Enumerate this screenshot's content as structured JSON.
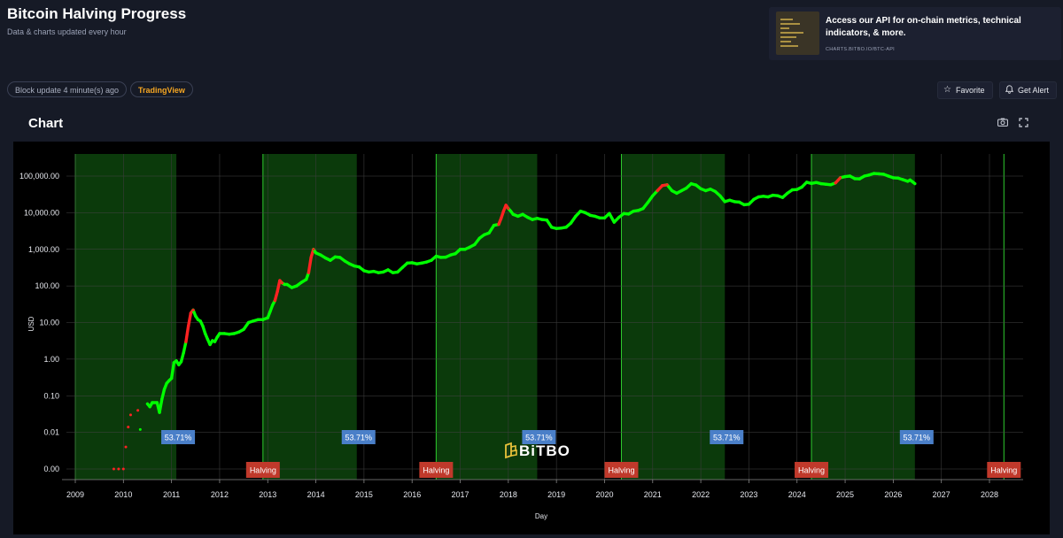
{
  "header": {
    "title": "Bitcoin Halving Progress",
    "subtitle": "Data & charts updated every hour"
  },
  "promo": {
    "text": "Access our API for on-chain metrics, technical indicators, & more.",
    "link": "CHARTS.BITBO.IO/BTC-API"
  },
  "toolbar": {
    "block_update": "Block update 4 minute(s) ago",
    "tradingview": "TradingView",
    "favorite": "Favorite",
    "get_alert": "Get Alert"
  },
  "chart_section": {
    "title": "Chart",
    "watermark": "BiTBO"
  },
  "colors": {
    "page_bg": "#161a26",
    "plot_bg": "#000000",
    "band": "#0b3a0b",
    "band_edge": "#2ecc2e",
    "price": "#00ff00",
    "price_hot": "#ff2222",
    "halving_label": "#c0392b",
    "pct_label": "#4a7fc8"
  },
  "icons": {
    "favorite": "star-icon",
    "alert": "bell-icon",
    "snapshot": "camera-icon",
    "fullscreen": "fullscreen-icon"
  },
  "chart_data": {
    "type": "scatter",
    "xlabel": "Day",
    "ylabel": "USD",
    "xlim": [
      2009,
      2028.4
    ],
    "ylim": [
      0.001,
      300000
    ],
    "y_scale": "log",
    "x_ticks": [
      "2009",
      "2010",
      "2011",
      "2012",
      "2013",
      "2014",
      "2015",
      "2016",
      "2017",
      "2018",
      "2019",
      "2020",
      "2021",
      "2022",
      "2023",
      "2024",
      "2025",
      "2026",
      "2027",
      "2028"
    ],
    "y_ticks": [
      {
        "value": 100000,
        "label": "100,000.00"
      },
      {
        "value": 10000,
        "label": "10,000.00"
      },
      {
        "value": 1000,
        "label": "1,000.00"
      },
      {
        "value": 100,
        "label": "100.00"
      },
      {
        "value": 10,
        "label": "10.00"
      },
      {
        "value": 1,
        "label": "1.00"
      },
      {
        "value": 0.1,
        "label": "0.10"
      },
      {
        "value": 0.01,
        "label": "0.01"
      },
      {
        "value": 0.001,
        "label": "0.00"
      }
    ],
    "grid": true,
    "bands": [
      {
        "start": 2009.0,
        "end": 2011.1
      },
      {
        "start": 2012.9,
        "end": 2014.85
      },
      {
        "start": 2016.5,
        "end": 2018.6
      },
      {
        "start": 2020.35,
        "end": 2022.5
      },
      {
        "start": 2024.3,
        "end": 2026.45
      },
      {
        "start": 2028.3,
        "end": 2028.3
      }
    ],
    "band_labels": [
      {
        "x": 2011.1,
        "label": "53.71%"
      },
      {
        "x": 2014.85,
        "label": "53.71%"
      },
      {
        "x": 2018.6,
        "label": "53.71%"
      },
      {
        "x": 2022.5,
        "label": "53.71%"
      },
      {
        "x": 2026.45,
        "label": "53.71%"
      }
    ],
    "halvings": [
      {
        "x": 2012.9,
        "label": "Halving"
      },
      {
        "x": 2016.5,
        "label": "Halving"
      },
      {
        "x": 2020.35,
        "label": "Halving"
      },
      {
        "x": 2024.3,
        "label": "Halving"
      },
      {
        "x": 2028.3,
        "label": "Halving"
      }
    ],
    "series": [
      {
        "points": [
          [
            2009.8,
            0.001
          ],
          [
            2009.9,
            0.001
          ],
          [
            2010.0,
            0.001
          ],
          [
            2010.05,
            0.004
          ],
          [
            2010.1,
            0.014
          ],
          [
            2010.15,
            0.03
          ],
          [
            2010.3,
            0.04
          ],
          [
            2010.35,
            0.012
          ],
          [
            2010.5,
            0.06
          ],
          [
            2010.55,
            0.05
          ],
          [
            2010.6,
            0.065
          ],
          [
            2010.7,
            0.065
          ],
          [
            2010.75,
            0.035
          ],
          [
            2010.8,
            0.08
          ],
          [
            2010.85,
            0.15
          ],
          [
            2010.9,
            0.22
          ],
          [
            2010.95,
            0.26
          ],
          [
            2011.0,
            0.3
          ],
          [
            2011.05,
            0.8
          ],
          [
            2011.1,
            0.9
          ],
          [
            2011.15,
            0.7
          ],
          [
            2011.2,
            0.85
          ],
          [
            2011.25,
            1.5
          ],
          [
            2011.3,
            3
          ],
          [
            2011.35,
            8
          ],
          [
            2011.4,
            18
          ],
          [
            2011.45,
            22
          ],
          [
            2011.5,
            15
          ],
          [
            2011.55,
            12
          ],
          [
            2011.6,
            11
          ],
          [
            2011.65,
            8
          ],
          [
            2011.7,
            5
          ],
          [
            2011.75,
            3.5
          ],
          [
            2011.8,
            2.5
          ],
          [
            2011.85,
            3.2
          ],
          [
            2011.9,
            3
          ],
          [
            2011.95,
            4
          ],
          [
            2012.0,
            5
          ],
          [
            2012.1,
            5
          ],
          [
            2012.2,
            4.8
          ],
          [
            2012.3,
            5
          ],
          [
            2012.4,
            5.5
          ],
          [
            2012.5,
            6.5
          ],
          [
            2012.6,
            10
          ],
          [
            2012.7,
            11
          ],
          [
            2012.8,
            12
          ],
          [
            2012.9,
            12
          ],
          [
            2013.0,
            13.5
          ],
          [
            2013.05,
            20
          ],
          [
            2013.1,
            30
          ],
          [
            2013.15,
            40
          ],
          [
            2013.2,
            70
          ],
          [
            2013.25,
            140
          ],
          [
            2013.3,
            120
          ],
          [
            2013.35,
            110
          ],
          [
            2013.4,
            110
          ],
          [
            2013.5,
            90
          ],
          [
            2013.6,
            100
          ],
          [
            2013.7,
            125
          ],
          [
            2013.8,
            150
          ],
          [
            2013.85,
            230
          ],
          [
            2013.9,
            600
          ],
          [
            2013.95,
            1000
          ],
          [
            2014.0,
            800
          ],
          [
            2014.1,
            700
          ],
          [
            2014.2,
            580
          ],
          [
            2014.3,
            500
          ],
          [
            2014.4,
            620
          ],
          [
            2014.5,
            600
          ],
          [
            2014.6,
            480
          ],
          [
            2014.7,
            400
          ],
          [
            2014.8,
            350
          ],
          [
            2014.9,
            330
          ],
          [
            2015.0,
            260
          ],
          [
            2015.1,
            240
          ],
          [
            2015.2,
            250
          ],
          [
            2015.3,
            230
          ],
          [
            2015.4,
            240
          ],
          [
            2015.5,
            275
          ],
          [
            2015.6,
            230
          ],
          [
            2015.7,
            240
          ],
          [
            2015.8,
            320
          ],
          [
            2015.9,
            420
          ],
          [
            2016.0,
            430
          ],
          [
            2016.1,
            400
          ],
          [
            2016.2,
            420
          ],
          [
            2016.3,
            450
          ],
          [
            2016.4,
            500
          ],
          [
            2016.5,
            650
          ],
          [
            2016.6,
            600
          ],
          [
            2016.7,
            610
          ],
          [
            2016.8,
            700
          ],
          [
            2016.9,
            760
          ],
          [
            2017.0,
            1000
          ],
          [
            2017.1,
            1000
          ],
          [
            2017.2,
            1150
          ],
          [
            2017.3,
            1350
          ],
          [
            2017.4,
            2000
          ],
          [
            2017.5,
            2500
          ],
          [
            2017.6,
            2800
          ],
          [
            2017.7,
            4500
          ],
          [
            2017.8,
            4800
          ],
          [
            2017.85,
            7000
          ],
          [
            2017.9,
            11000
          ],
          [
            2017.95,
            16000
          ],
          [
            2018.0,
            13000
          ],
          [
            2018.05,
            11000
          ],
          [
            2018.1,
            9000
          ],
          [
            2018.2,
            8000
          ],
          [
            2018.3,
            9000
          ],
          [
            2018.4,
            7500
          ],
          [
            2018.5,
            6500
          ],
          [
            2018.6,
            7000
          ],
          [
            2018.7,
            6500
          ],
          [
            2018.8,
            6300
          ],
          [
            2018.9,
            4000
          ],
          [
            2019.0,
            3700
          ],
          [
            2019.1,
            3800
          ],
          [
            2019.2,
            4000
          ],
          [
            2019.3,
            5200
          ],
          [
            2019.4,
            8000
          ],
          [
            2019.5,
            11000
          ],
          [
            2019.6,
            10000
          ],
          [
            2019.7,
            8500
          ],
          [
            2019.8,
            8000
          ],
          [
            2019.9,
            7200
          ],
          [
            2020.0,
            7200
          ],
          [
            2020.1,
            9500
          ],
          [
            2020.2,
            5500
          ],
          [
            2020.3,
            7500
          ],
          [
            2020.4,
            9500
          ],
          [
            2020.5,
            9200
          ],
          [
            2020.6,
            11000
          ],
          [
            2020.7,
            11500
          ],
          [
            2020.8,
            13000
          ],
          [
            2020.9,
            19000
          ],
          [
            2021.0,
            29000
          ],
          [
            2021.1,
            40000
          ],
          [
            2021.2,
            55000
          ],
          [
            2021.3,
            58000
          ],
          [
            2021.4,
            40000
          ],
          [
            2021.5,
            34000
          ],
          [
            2021.6,
            40000
          ],
          [
            2021.7,
            47000
          ],
          [
            2021.8,
            62000
          ],
          [
            2021.9,
            57000
          ],
          [
            2022.0,
            45000
          ],
          [
            2022.1,
            40000
          ],
          [
            2022.2,
            44000
          ],
          [
            2022.3,
            38000
          ],
          [
            2022.4,
            29000
          ],
          [
            2022.5,
            20000
          ],
          [
            2022.6,
            22000
          ],
          [
            2022.7,
            20000
          ],
          [
            2022.8,
            19500
          ],
          [
            2022.9,
            16500
          ],
          [
            2023.0,
            17000
          ],
          [
            2023.1,
            23000
          ],
          [
            2023.2,
            27000
          ],
          [
            2023.3,
            28000
          ],
          [
            2023.4,
            27000
          ],
          [
            2023.5,
            30000
          ],
          [
            2023.6,
            29000
          ],
          [
            2023.7,
            26000
          ],
          [
            2023.8,
            34000
          ],
          [
            2023.9,
            42000
          ],
          [
            2024.0,
            43000
          ],
          [
            2024.1,
            50000
          ],
          [
            2024.2,
            68000
          ],
          [
            2024.3,
            63000
          ],
          [
            2024.4,
            67000
          ],
          [
            2024.5,
            62000
          ],
          [
            2024.6,
            60000
          ],
          [
            2024.7,
            58000
          ],
          [
            2024.8,
            65000
          ],
          [
            2024.9,
            90000
          ],
          [
            2025.0,
            97000
          ],
          [
            2025.1,
            100000
          ],
          [
            2025.2,
            85000
          ],
          [
            2025.3,
            84000
          ],
          [
            2025.4,
            100000
          ],
          [
            2025.5,
            107000
          ],
          [
            2025.6,
            118000
          ],
          [
            2025.7,
            115000
          ],
          [
            2025.8,
            112000
          ],
          [
            2025.9,
            100000
          ],
          [
            2026.0,
            90000
          ],
          [
            2026.1,
            88000
          ],
          [
            2026.2,
            80000
          ],
          [
            2026.3,
            72000
          ],
          [
            2026.35,
            78000
          ],
          [
            2026.4,
            70000
          ],
          [
            2026.45,
            62000
          ]
        ]
      }
    ],
    "hot_ranges": [
      [
        2009.75,
        2010.02
      ],
      [
        2010.05,
        2010.3
      ],
      [
        2011.3,
        2011.45
      ],
      [
        2013.15,
        2013.3
      ],
      [
        2013.85,
        2013.95
      ],
      [
        2017.75,
        2018.0
      ],
      [
        2021.05,
        2021.3
      ],
      [
        2024.75,
        2024.9
      ]
    ]
  }
}
